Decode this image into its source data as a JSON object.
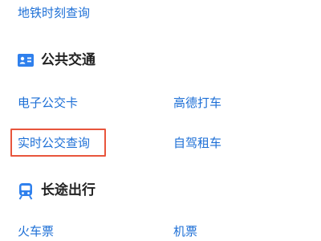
{
  "metro": {
    "schedule_link": "地铁时刻查询"
  },
  "public_transit": {
    "title": "公共交通",
    "icon": "id-card-icon",
    "items": [
      "电子公交卡",
      "高德打车",
      "实时公交查询",
      "自驾租车"
    ]
  },
  "long_distance": {
    "title": "长途出行",
    "icon": "train-icon",
    "items": [
      "火车票",
      "机票"
    ]
  },
  "colors": {
    "link": "#1d6fd6",
    "highlight": "#e8553c",
    "icon": "#2f80ed"
  }
}
